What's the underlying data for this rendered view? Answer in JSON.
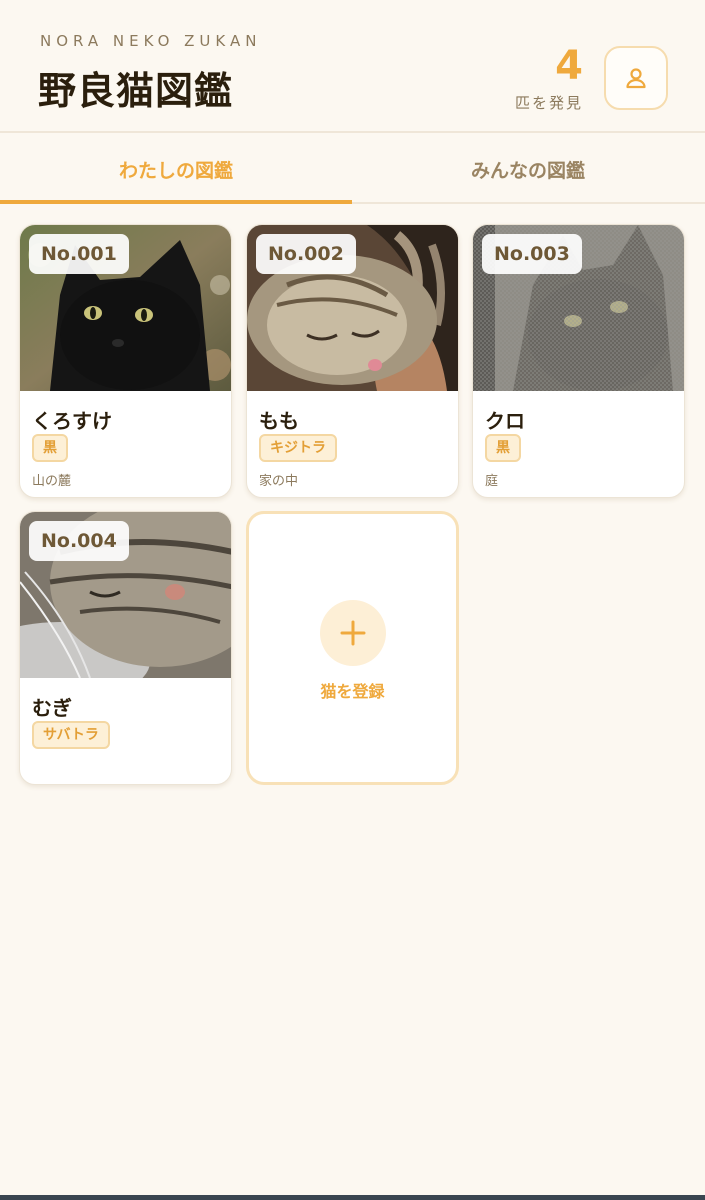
{
  "header": {
    "subtitle": "NORA NEKO ZUKAN",
    "title": "野良猫図鑑",
    "count": "4",
    "count_label": "匹を発見",
    "profile_icon": "user-icon"
  },
  "tabs": [
    {
      "label": "わたしの図鑑",
      "active": true
    },
    {
      "label": "みんなの図鑑",
      "active": false
    }
  ],
  "cats": [
    {
      "no": "No.001",
      "name": "くろすけ",
      "tag": "黒",
      "place": "山の麓"
    },
    {
      "no": "No.002",
      "name": "もも",
      "tag": "キジトラ",
      "place": "家の中"
    },
    {
      "no": "No.003",
      "name": "クロ",
      "tag": "黒",
      "place": "庭"
    },
    {
      "no": "No.004",
      "name": "むぎ",
      "tag": "サバトラ",
      "place": ""
    }
  ],
  "add_card": {
    "label": "猫を登録",
    "icon": "plus-icon"
  },
  "colors": {
    "accent": "#efa93d",
    "background": "#fcf8f1",
    "text": "#2b1f0d",
    "muted": "#8c7a5d"
  }
}
